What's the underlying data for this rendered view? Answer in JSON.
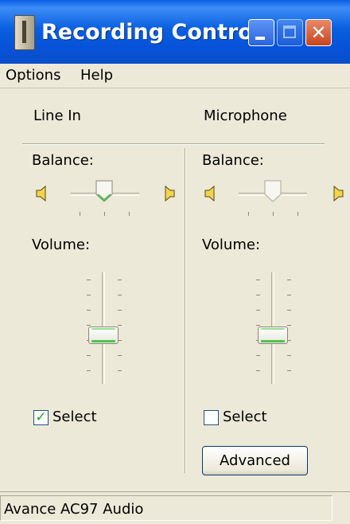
{
  "window": {
    "title": "Recording Control"
  },
  "menu": {
    "options": "Options",
    "help": "Help"
  },
  "channels": [
    {
      "name": "Line In",
      "balance_label": "Balance:",
      "volume_label": "Volume:",
      "select_label": "Select",
      "selected": true,
      "balance_level": 0.5,
      "volume_level": 0.46
    },
    {
      "name": "Microphone",
      "balance_label": "Balance:",
      "volume_label": "Volume:",
      "select_label": "Select",
      "selected": false,
      "balance_level": 0.5,
      "volume_level": 0.46,
      "advanced_label": "Advanced"
    }
  ],
  "status": {
    "device": "Avance AC97 Audio"
  },
  "icons": {
    "app": "mixer-icon",
    "minimize": "minimize-icon",
    "maximize": "maximize-icon",
    "close": "close-icon",
    "speaker_left": "speaker-left-icon",
    "speaker_right": "speaker-right-icon"
  },
  "colors": {
    "titlebar": "#0a5fe0",
    "window_bg": "#ece9d8",
    "close_button": "#c8451c",
    "slider_accent": "#4fc34f",
    "check_mark": "#21a121"
  }
}
